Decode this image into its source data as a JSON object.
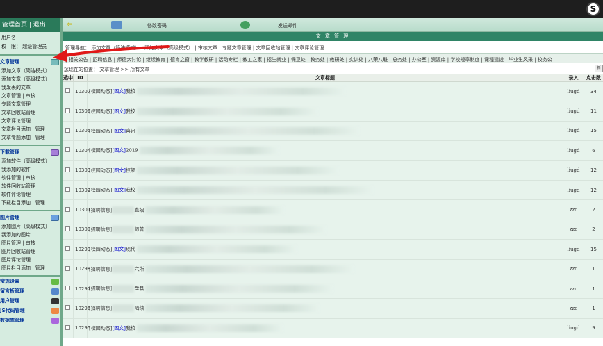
{
  "toolbar": {
    "change_password": "修改密码",
    "send_mail": "发送邮件"
  },
  "sidebar": {
    "top_home": "管理首页",
    "top_logout": "退出",
    "user_label": "用户名",
    "role_label": "权　限：",
    "role_value": "超级管理员",
    "article": {
      "title": "文章管理",
      "items": [
        "添加文章（简洁模式）",
        "添加文章（高级模式）",
        "我发表的文章",
        "文章管理 | 审核",
        "专题文章管理",
        "文章回收站管理",
        "文章评论管理",
        "文章栏目添加 | 管理",
        "文章专题添加 | 管理"
      ]
    },
    "download": {
      "title": "下载管理",
      "items": [
        "添加软件（高级模式）",
        "我添加的软件",
        "软件管理 | 审核",
        "软件回收站管理",
        "软件评论管理",
        "下载栏目添加 | 管理"
      ]
    },
    "picture": {
      "title": "图片管理",
      "items": [
        "添加图片（高级模式）",
        "我添加的图片",
        "图片管理 | 审核",
        "图片回收站管理",
        "图片评论管理",
        "图片栏目添加 | 管理"
      ]
    },
    "misc": [
      "常规设置",
      "留言板管理",
      "用户管理",
      "JS代码管理",
      "数据库管理"
    ]
  },
  "main": {
    "title": "文 章 管 理",
    "links": "管理导航： 添加文章（简洁模式） | 添加文章（高级模式） | 审核文章 | 专题文章管理 | 文章回收站管理 | 文章评论管理",
    "tabs": "| 相关公告 | 招聘信息 | 师德大讨论 | 继续教育 | 德育之窗 | 教学教研 | 活动专栏 | 教工之家 | 招生就业 | 保卫处 | 教务处 | 教研处 | 实训处 | 八荣八耻 | 总务处 | 办公室 | 资源库 | 学校规章制度 | 课程建设 | 毕业生风采 | 校务公",
    "crumb_label": "您现在的位置：",
    "crumb_path": "文章管理 >> 所有文章",
    "crumb_btn": "新",
    "columns": {
      "select": "选中",
      "id": "ID",
      "title": "文章标题",
      "author": "录入",
      "hits": "点击数"
    },
    "rows": [
      {
        "id": "10307",
        "cat": "[校园动态]",
        "pic": "[图文]",
        "title": "我校",
        "author": "liugd",
        "hits": "34"
      },
      {
        "id": "10306",
        "cat": "[校园动态]",
        "pic": "[图文]",
        "title": "我校",
        "author": "liugd",
        "hits": "11"
      },
      {
        "id": "10305",
        "cat": "[校园动态]",
        "pic": "[图文]",
        "title": "喜讯",
        "author": "liugd",
        "hits": "15"
      },
      {
        "id": "10304",
        "cat": "[校园动态]",
        "pic": "[图文]",
        "title": "2019",
        "author": "liugd",
        "hits": "6"
      },
      {
        "id": "10303",
        "cat": "[校园动态]",
        "pic": "[图文]",
        "title": "校领",
        "author": "liugd",
        "hits": "12"
      },
      {
        "id": "10302",
        "cat": "[校园动态]",
        "pic": "[图文]",
        "title": "我校",
        "author": "liugd",
        "hits": "12"
      },
      {
        "id": "10301",
        "cat": "[招聘信息]",
        "pic": "",
        "title": "直招",
        "author": "zzc",
        "hits": "2"
      },
      {
        "id": "10300",
        "cat": "[招聘信息]",
        "pic": "",
        "title": "师普",
        "author": "zzc",
        "hits": "2"
      },
      {
        "id": "10299",
        "cat": "[校园动态]",
        "pic": "[图文]",
        "title": "现代",
        "author": "liugd",
        "hits": "15"
      },
      {
        "id": "10298",
        "cat": "[招聘信息]",
        "pic": "",
        "title": "六所",
        "author": "zzc",
        "hits": "1"
      },
      {
        "id": "10297",
        "cat": "[招聘信息]",
        "pic": "",
        "title": "盘县",
        "author": "zzc",
        "hits": "1"
      },
      {
        "id": "10296",
        "cat": "[招聘信息]",
        "pic": "",
        "title": "陆续",
        "author": "zzc",
        "hits": "1"
      },
      {
        "id": "10295",
        "cat": "[校园动态]",
        "pic": "[图文]",
        "title": "我校",
        "author": "liugd",
        "hits": "9"
      }
    ]
  }
}
